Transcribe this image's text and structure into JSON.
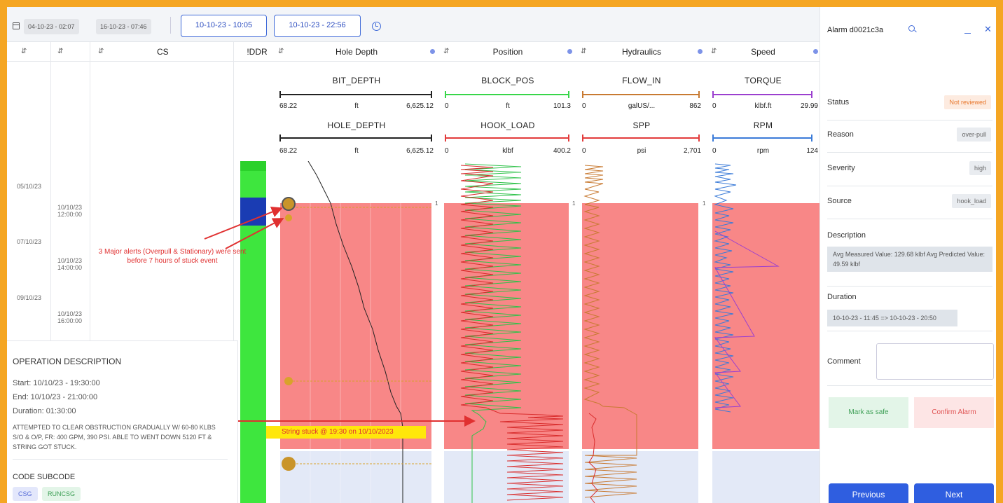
{
  "toolbar": {
    "date_start": "04-10-23 - 02:07",
    "date_end": "16-10-23 - 07:46",
    "range_from": "10-10-23 - 10:05",
    "range_to": "10-10-23 - 22:56"
  },
  "columns": {
    "sort_glyph": "⇵",
    "cs": "CS",
    "ddr": "!DDR",
    "hole_depth": "Hole Depth",
    "position": "Position",
    "hydraulics": "Hydraulics",
    "speed": "Speed"
  },
  "tracks": {
    "hole_depth": {
      "c1": {
        "name": "BIT_DEPTH",
        "min": "68.22",
        "unit": "ft",
        "max": "6,625.12",
        "color": "#222222"
      },
      "c2": {
        "name": "HOLE_DEPTH",
        "min": "68.22",
        "unit": "ft",
        "max": "6,625.12",
        "color": "#222222"
      }
    },
    "position": {
      "c1": {
        "name": "BLOCK_POS",
        "min": "0",
        "unit": "ft",
        "max": "101.3",
        "color": "#38d64a"
      },
      "c2": {
        "name": "HOOK_LOAD",
        "min": "0",
        "unit": "klbf",
        "max": "400.2",
        "color": "#e23b3b"
      }
    },
    "hydraulics": {
      "c1": {
        "name": "FLOW_IN",
        "min": "0",
        "unit": "galUS/...",
        "max": "862",
        "color": "#c87a32"
      },
      "c2": {
        "name": "SPP",
        "min": "0",
        "unit": "psi",
        "max": "2,701",
        "color": "#e23b3b"
      }
    },
    "speed": {
      "c1": {
        "name": "TORQUE",
        "min": "0",
        "unit": "klbf.ft",
        "max": "29.99",
        "color": "#9b3fcf"
      },
      "c2": {
        "name": "RPM",
        "min": "0",
        "unit": "rpm",
        "max": "124",
        "color": "#3b7bd8"
      }
    }
  },
  "timeline": {
    "dates": [
      "05/10/23",
      "07/10/23",
      "09/10/23"
    ],
    "times": [
      {
        "date": "10/10/23",
        "time": "12:00:00"
      },
      {
        "date": "10/10/23",
        "time": "14:00:00"
      },
      {
        "date": "10/10/23",
        "time": "16:00:00"
      }
    ],
    "marker": "1"
  },
  "annotations": {
    "alert": "3 Major alerts (Overpull & Stationary) were sent before 7 hours of stuck event",
    "stuck": "String stuck @ 19:30 on 10/10/2023"
  },
  "operation": {
    "title": "OPERATION DESCRIPTION",
    "start": "Start: 10/10/23 - 19:30:00",
    "end": "End: 10/10/23 - 21:00:00",
    "duration": "Duration: 01:30:00",
    "description": "ATTEMPTED TO CLEAR OBSTRUCTION GRADUALLY W/ 60-80 KLBS S/O & O/P, FR: 400 GPM, 390 PSI. ABLE TO WENT DOWN 5120 FT & STRING GOT STUCK.",
    "codes_label": "CODE  SUBCODE",
    "code": "CSG",
    "subcode": "RUNCSG"
  },
  "alarm": {
    "title": "Alarm d0021c3a",
    "status_label": "Status",
    "status": "Not reviewed",
    "reason_label": "Reason",
    "reason": "over-pull",
    "severity_label": "Severity",
    "severity": "high",
    "source_label": "Source",
    "source": "hook_load",
    "description_label": "Description",
    "description": "Avg Measured Value: 129.68 klbf Avg Predicted Value: 49.59 klbf",
    "duration_label": "Duration",
    "duration": "10-10-23 - 11:45 => 10-10-23 - 20:50",
    "comment_label": "Comment",
    "mark_safe": "Mark as safe",
    "confirm": "Confirm Alarm",
    "previous": "Previous",
    "next": "Next"
  }
}
